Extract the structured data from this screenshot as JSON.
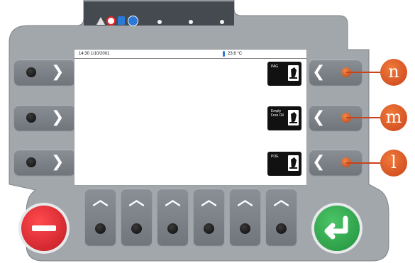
{
  "screen": {
    "status_left": "14:30 1/10/2001",
    "status_temp": "23,6 °C"
  },
  "softkeys": [
    {
      "label": "PAG",
      "icon": "oil-bottle-icon"
    },
    {
      "label": "Empty Free Oil",
      "icon": "oil-bottle-icon"
    },
    {
      "label": "POE",
      "icon": "oil-bottle-icon"
    }
  ],
  "callouts": [
    "n",
    "m",
    "l"
  ],
  "side_glyphs": {
    "right": "❯",
    "left": "❮",
    "up": "︿"
  },
  "colors": {
    "panel": "#9ea3a8",
    "stop_button": "#d8232a",
    "enter_button": "#2fa44a",
    "callout": "#d9541f"
  }
}
